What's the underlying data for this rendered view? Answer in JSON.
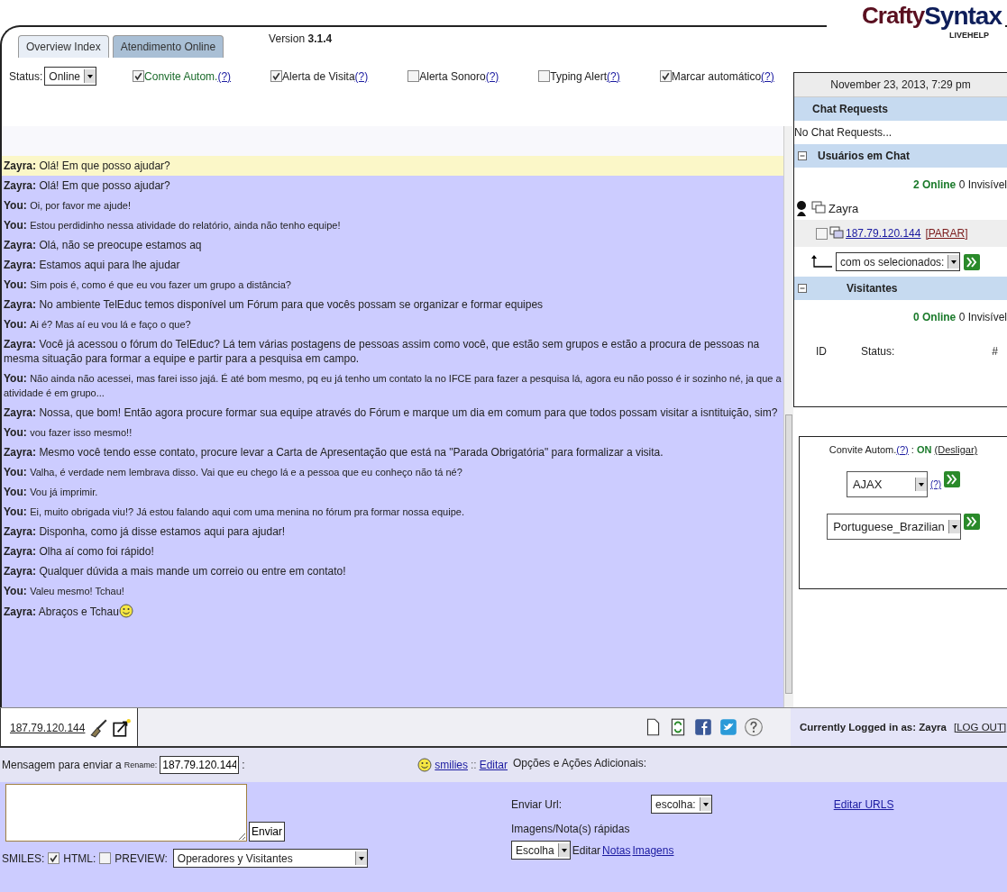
{
  "logo": {
    "part_1": "Crafty",
    "part_2": "Syntax",
    "tagline": "LIVEHELP"
  },
  "tabs": [
    {
      "label": "Overview Index",
      "selected": false
    },
    {
      "label": "Atendimento Online",
      "selected": true
    }
  ],
  "version": {
    "label": "Version",
    "number": "3.1.4"
  },
  "status": {
    "label": "Status:",
    "value": "Online"
  },
  "options": [
    {
      "label": "Convite Autom.",
      "help": "(?)",
      "checked": true
    },
    {
      "label": "Alerta de Visita",
      "help": "(?)",
      "checked": true
    },
    {
      "label": "Alerta Sonoro",
      "help": "(?)",
      "checked": false
    },
    {
      "label": "Typing Alert",
      "help": "(?)",
      "checked": false
    },
    {
      "label": "Marcar automático",
      "help": "(?)",
      "checked": true
    }
  ],
  "messages": [
    {
      "speaker": "Zayra:",
      "text": "Olá! Em que posso ajudar?",
      "kind": "operator",
      "highlighted": true,
      "emoticon": false
    },
    {
      "speaker": "Zayra:",
      "text": "Olá! Em que posso ajudar?",
      "kind": "operator",
      "highlighted": false,
      "emoticon": false
    },
    {
      "speaker": "You:",
      "text": "Oi, por favor me ajude!",
      "kind": "visitor",
      "highlighted": false,
      "emoticon": false
    },
    {
      "speaker": "You:",
      "text": "Estou perdidinho nessa atividade do relatório, ainda não tenho equipe!",
      "kind": "visitor",
      "highlighted": false,
      "emoticon": false
    },
    {
      "speaker": "Zayra:",
      "text": "Olá, não se preocupe estamos aq",
      "kind": "operator",
      "highlighted": false,
      "emoticon": false
    },
    {
      "speaker": "Zayra:",
      "text": "Estamos aqui para lhe ajudar",
      "kind": "operator",
      "highlighted": false,
      "emoticon": false
    },
    {
      "speaker": "You:",
      "text": "Sim pois é, como é que eu vou fazer um grupo a distância?",
      "kind": "visitor",
      "highlighted": false,
      "emoticon": false
    },
    {
      "speaker": "Zayra:",
      "text": "No ambiente TelEduc temos disponível um Fórum para que vocês possam se organizar e formar equipes",
      "kind": "operator",
      "highlighted": false,
      "emoticon": false
    },
    {
      "speaker": "You:",
      "text": "Ai é? Mas aí eu vou lá e faço o que?",
      "kind": "visitor",
      "highlighted": false,
      "emoticon": false
    },
    {
      "speaker": "Zayra:",
      "text": "Você já acessou o fórum do TelEduc? Lá tem várias postagens de pessoas assim como você, que estão sem grupos e estão a procura de pessoas na mesma situação para formar a equipe e partir para a pesquisa em campo.",
      "kind": "operator",
      "highlighted": false,
      "emoticon": false
    },
    {
      "speaker": "You:",
      "text": "Não ainda não acessei, mas farei isso jajá. É até bom mesmo, pq eu já tenho um contato la no IFCE para fazer a pesquisa lá, agora eu não posso é ir sozinho né, ja que a atividade é em grupo...",
      "kind": "visitor",
      "highlighted": false,
      "emoticon": false
    },
    {
      "speaker": "Zayra:",
      "text": "Nossa, que bom! Então agora procure formar sua equipe através do Fórum e marque um dia em comum para que todos possam visitar a isntituição, sim?",
      "kind": "operator",
      "highlighted": false,
      "emoticon": false
    },
    {
      "speaker": "You:",
      "text": "vou fazer isso mesmo!!",
      "kind": "visitor",
      "highlighted": false,
      "emoticon": false
    },
    {
      "speaker": "Zayra:",
      "text": "Mesmo você tendo esse contato, procure levar a Carta de Apresentação que está na \"Parada Obrigatória\" para formalizar a visita.",
      "kind": "operator",
      "highlighted": false,
      "emoticon": false
    },
    {
      "speaker": "You:",
      "text": "Valha, é verdade nem lembrava disso. Vai que eu chego lá e a pessoa que eu conheço não tá né?",
      "kind": "visitor",
      "highlighted": false,
      "emoticon": false
    },
    {
      "speaker": "You:",
      "text": "Vou já imprimir.",
      "kind": "visitor",
      "highlighted": false,
      "emoticon": false
    },
    {
      "speaker": "You:",
      "text": "Ei, muito obrigada viu!? Já estou falando aqui com uma menina no fórum pra formar nossa equipe.",
      "kind": "visitor",
      "highlighted": false,
      "emoticon": false
    },
    {
      "speaker": "Zayra:",
      "text": "Disponha, como já disse estamos aqui para ajudar!",
      "kind": "operator",
      "highlighted": false,
      "emoticon": false
    },
    {
      "speaker": "Zayra:",
      "text": "Olha aí como foi rápido!",
      "kind": "operator",
      "highlighted": false,
      "emoticon": false
    },
    {
      "speaker": "Zayra:",
      "text": "Qualquer dúvida a mais mande um correio ou entre em contato!",
      "kind": "operator",
      "highlighted": false,
      "emoticon": false
    },
    {
      "speaker": "You:",
      "text": "Valeu mesmo! Tchau!",
      "kind": "visitor",
      "highlighted": false,
      "emoticon": false
    },
    {
      "speaker": "Zayra:",
      "text": "Abraços e Tchau",
      "kind": "operator",
      "highlighted": false,
      "emoticon": true
    }
  ],
  "session_tab": {
    "label": "187.79.120.144"
  },
  "toolbar": [
    {
      "kind": "page"
    },
    {
      "kind": "refresh"
    },
    {
      "kind": "facebook"
    },
    {
      "kind": "twitter"
    },
    {
      "kind": "help"
    }
  ],
  "login": {
    "label": "Currently Logged in as: Zayra",
    "logout": "[LOG OUT]"
  },
  "message_bar": {
    "label": "Mensagem para enviar a",
    "rename_label": "Rename:",
    "rename_value": "187.79.120.144",
    "colon": ":",
    "smilies": "smilies",
    "separator": "::",
    "edit": "Editar"
  },
  "compose": {
    "send": "Enviar"
  },
  "flags": [
    {
      "label": "SMILES:",
      "checked": true
    },
    {
      "label": "HTML:",
      "checked": false
    }
  ],
  "preview": {
    "label": "PREVIEW:",
    "value": "Operadores y Visitantes"
  },
  "extra": {
    "title": "Opções e Ações Adicionais:",
    "url_label": "Enviar Url:",
    "url_select": "escolha:",
    "edit_urls": "Editar URLS",
    "quick_label": "Imagens/Nota(s) rápidas",
    "quick_select": "Escolha",
    "edit": "Editar",
    "notes": "Notas",
    "images": "Imagens"
  },
  "sidebar": {
    "date": "November 23, 2013, 7:29 pm",
    "chat_requests": {
      "title": "Chat Requests",
      "empty": "No Chat Requests..."
    },
    "users": {
      "title": "Usuários em Chat",
      "expanded": true,
      "online": "2 Online",
      "invisible": "0 Invisível",
      "operator": "Zayra",
      "visitor_ip": "187.79.120.144",
      "stop": "[PARAR]",
      "checked": false,
      "action_select": "com os selecionados:"
    },
    "visitors": {
      "title": "Visitantes",
      "expanded": true,
      "online": "0 Online",
      "invisible": "0 Invisível",
      "columns": [
        "ID",
        "Status:",
        "#"
      ]
    }
  },
  "auto_invite": {
    "label": "Convite Autom.",
    "help": "(?)",
    "separator": ":",
    "state": "ON",
    "toggle": "(Desligar)"
  },
  "transport": {
    "value": "AJAX",
    "help": "(?)"
  },
  "language": {
    "value": "Portuguese_Brazilian"
  }
}
